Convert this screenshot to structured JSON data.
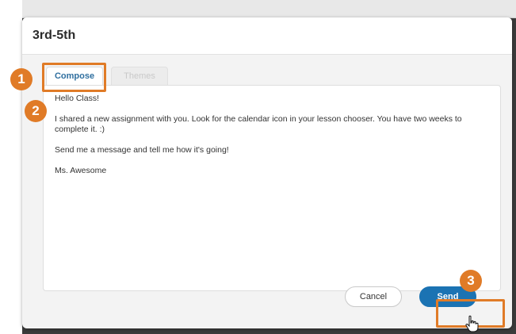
{
  "window": {
    "title": "3rd-5th"
  },
  "tabs": [
    {
      "label": "Compose",
      "active": true
    },
    {
      "label": "Themes",
      "active": false
    }
  ],
  "message": {
    "lines": [
      "Hello Class!",
      "",
      "I shared a new assignment with you. Look for the calendar icon in your lesson chooser. You have two weeks to complete it. :)",
      "",
      "Send me a message and tell me how it's going!",
      "",
      "Ms. Awesome"
    ]
  },
  "buttons": {
    "cancel": "Cancel",
    "send": "Send"
  },
  "annotations": {
    "step1": "1",
    "step2": "2",
    "step3": "3"
  },
  "colors": {
    "highlight": "#e07b27",
    "send_button": "#1b73b3",
    "tab_active_text": "#2f6f9f"
  }
}
